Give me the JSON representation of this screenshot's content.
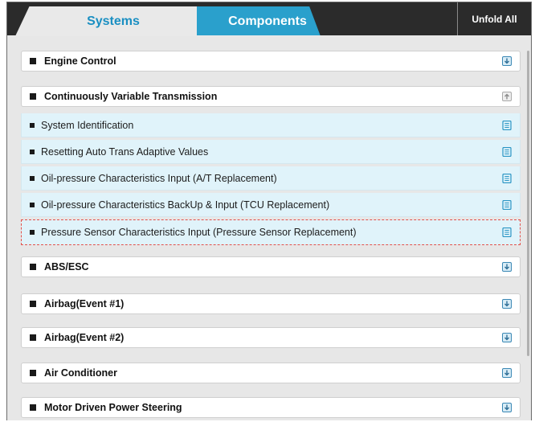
{
  "tabs": {
    "systems_label": "Systems",
    "components_label": "Components",
    "unfold_label": "Unfold All"
  },
  "groups": [
    {
      "label": "Engine Control",
      "expanded": false,
      "icon": "expand-down-icon"
    },
    {
      "label": "Continuously Variable Transmission",
      "expanded": true,
      "icon": "collapse-up-icon",
      "items": [
        {
          "label": "System Identification",
          "icon": "document-icon",
          "selected": false
        },
        {
          "label": "Resetting Auto Trans Adaptive Values",
          "icon": "document-icon",
          "selected": false
        },
        {
          "label": "Oil-pressure Characteristics Input (A/T Replacement)",
          "icon": "document-icon",
          "selected": false
        },
        {
          "label": "Oil-pressure Characteristics BackUp & Input (TCU Replacement)",
          "icon": "document-icon",
          "selected": false
        },
        {
          "label": "Pressure Sensor Characteristics Input (Pressure Sensor Replacement)",
          "icon": "document-icon",
          "selected": true
        }
      ]
    },
    {
      "label": "ABS/ESC",
      "expanded": false,
      "icon": "expand-down-icon"
    },
    {
      "label": "Airbag(Event #1)",
      "expanded": false,
      "icon": "expand-down-icon"
    },
    {
      "label": "Airbag(Event #2)",
      "expanded": false,
      "icon": "expand-down-icon"
    },
    {
      "label": "Air Conditioner",
      "expanded": false,
      "icon": "expand-down-icon"
    },
    {
      "label": "Motor Driven Power Steering",
      "expanded": false,
      "icon": "expand-down-icon"
    }
  ],
  "colors": {
    "accent": "#2aa0cc",
    "active_tab_text": "#1a8fc2",
    "header_bg": "#2b2b2b",
    "selected_border": "#e3504a",
    "sub_row_bg": "#e0f3fa"
  }
}
